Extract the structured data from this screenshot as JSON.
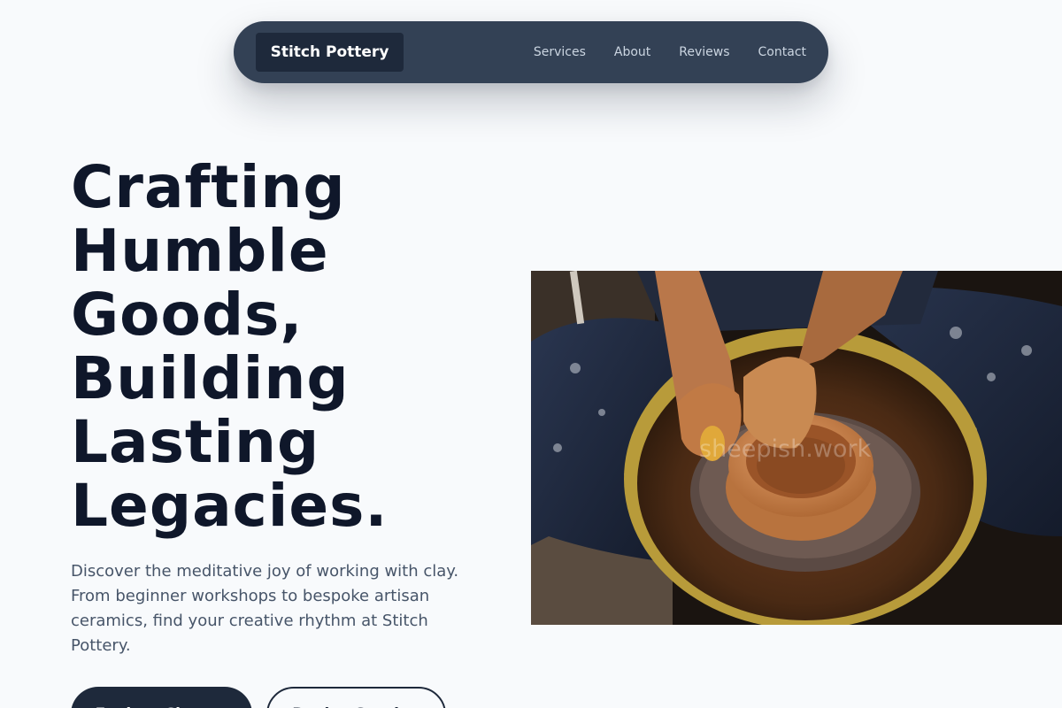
{
  "nav": {
    "brand": "Stitch Pottery",
    "links": [
      "Services",
      "About",
      "Reviews",
      "Contact"
    ]
  },
  "hero": {
    "headline_lines": [
      "Crafting",
      "Humble",
      "Goods,",
      "Building",
      "Lasting",
      "Legacies."
    ],
    "subtext": "Discover the meditative joy of working with clay. From beginner workshops to bespoke artisan ceramics, find your creative rhythm at Stitch Pottery.",
    "primary_cta": "Explore Classes",
    "secondary_cta": "Book a Session",
    "image_watermark": "sheepish.work"
  },
  "colors": {
    "page_bg": "#f8fafc",
    "nav_bg": "#334155",
    "brand_bg": "#1e293b",
    "heading": "#0f172a",
    "body_text": "#475569"
  }
}
